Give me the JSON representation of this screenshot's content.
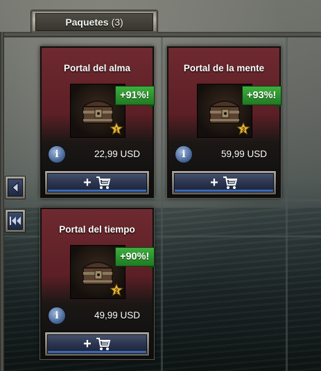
{
  "tab": {
    "label": "Paquetes",
    "count": "(3)"
  },
  "offers": [
    {
      "title": "Portal del alma",
      "bonus": "+91%!",
      "price": "22,99 USD",
      "level": "1"
    },
    {
      "title": "Portal de la mente",
      "bonus": "+93%!",
      "price": "59,99 USD",
      "level": "3"
    },
    {
      "title": "Portal del tiempo",
      "bonus": "+90%!",
      "price": "49,99 USD",
      "level": "2"
    }
  ],
  "buy_label": "+",
  "info_label": "i",
  "colors": {
    "bonus_green": "#2f9a32",
    "card_red": "#6e2a30",
    "button_blue": "#2b3550"
  },
  "icons": [
    "info-icon",
    "shopping-cart-icon",
    "chest-icon",
    "level-star-icon",
    "arrow-left-icon",
    "double-arrow-left-icon"
  ]
}
